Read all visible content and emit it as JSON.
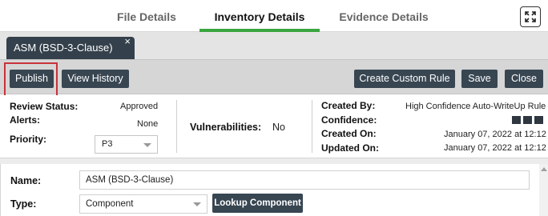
{
  "top_tabs": [
    "File Details",
    "Inventory Details",
    "Evidence Details"
  ],
  "doc_tab": {
    "label": "ASM (BSD-3-Clause)",
    "close": "×"
  },
  "toolbar": {
    "publish": "Publish",
    "view_history": "View History",
    "create_custom_rule": "Create Custom Rule",
    "save": "Save",
    "close": "Close"
  },
  "info": {
    "review_status_label": "Review Status:",
    "review_status_value": "Approved",
    "alerts_label": "Alerts:",
    "alerts_value": "None",
    "priority_label": "Priority:",
    "priority_value": "P3",
    "vulnerabilities_label": "Vulnerabilities:",
    "vulnerabilities_value": "No",
    "created_by_label": "Created By:",
    "created_by_value": "High Confidence Auto-WriteUp Rule",
    "confidence_label": "Confidence:",
    "confidence_level": "3 squares",
    "created_on_label": "Created On:",
    "created_on_value": "January 07, 2022 at 12:12",
    "updated_on_label": "Updated On:",
    "updated_on_value": "January 07, 2022 at 12:12"
  },
  "form": {
    "name_label": "Name:",
    "name_value": "ASM (BSD-3-Clause)",
    "type_label": "Type:",
    "type_value": "Component",
    "lookup_button": "Lookup Component"
  },
  "colors": {
    "accent_green": "#3aa53f",
    "button_dark": "#384652",
    "highlight_red": "#c8323a"
  },
  "icons": [
    "expand-icon",
    "close-icon",
    "chevron-down-icon",
    "confidence-square-icon"
  ]
}
